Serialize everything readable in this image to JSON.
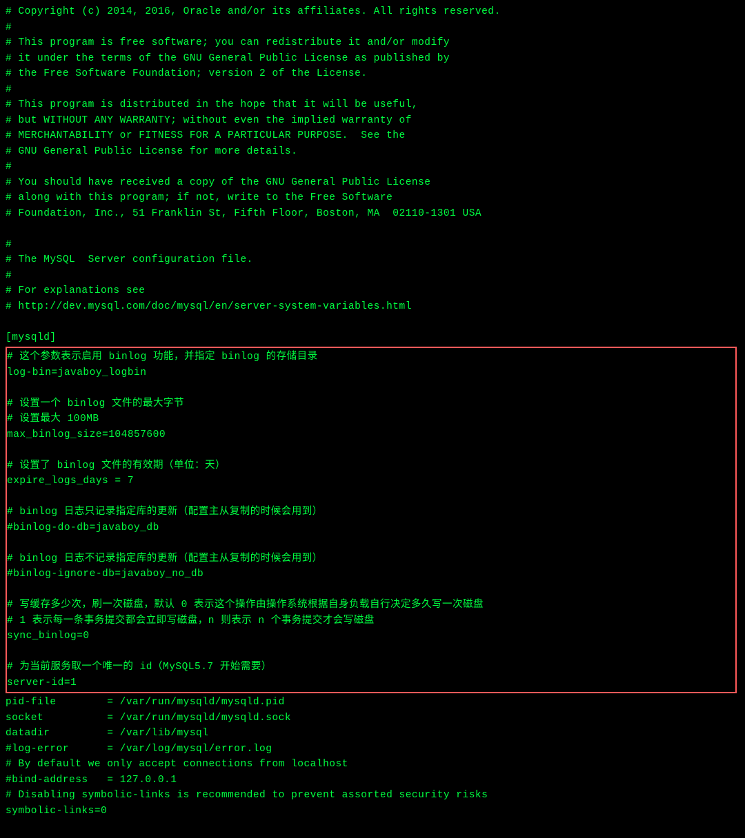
{
  "colors": {
    "background": "#000000",
    "text": "#00ff41",
    "highlightBorder": "#ff5a5a"
  },
  "preLines": [
    "# Copyright (c) 2014, 2016, Oracle and/or its affiliates. All rights reserved.",
    "#",
    "# This program is free software; you can redistribute it and/or modify",
    "# it under the terms of the GNU General Public License as published by",
    "# the Free Software Foundation; version 2 of the License.",
    "#",
    "# This program is distributed in the hope that it will be useful,",
    "# but WITHOUT ANY WARRANTY; without even the implied warranty of",
    "# MERCHANTABILITY or FITNESS FOR A PARTICULAR PURPOSE.  See the",
    "# GNU General Public License for more details.",
    "#",
    "# You should have received a copy of the GNU General Public License",
    "# along with this program; if not, write to the Free Software",
    "# Foundation, Inc., 51 Franklin St, Fifth Floor, Boston, MA  02110-1301 USA",
    "",
    "#",
    "# The MySQL  Server configuration file.",
    "#",
    "# For explanations see",
    "# http://dev.mysql.com/doc/mysql/en/server-system-variables.html",
    "",
    "[mysqld]"
  ],
  "highlightLines": [
    "# 这个参数表示启用 binlog 功能，并指定 binlog 的存储目录",
    "log-bin=javaboy_logbin",
    "",
    "# 设置一个 binlog 文件的最大字节",
    "# 设置最大 100MB",
    "max_binlog_size=104857600",
    "",
    "# 设置了 binlog 文件的有效期（单位：天）",
    "expire_logs_days = 7",
    "",
    "# binlog 日志只记录指定库的更新（配置主从复制的时候会用到）",
    "#binlog-do-db=javaboy_db",
    "",
    "# binlog 日志不记录指定库的更新（配置主从复制的时候会用到）",
    "#binlog-ignore-db=javaboy_no_db",
    "",
    "# 写缓存多少次，刷一次磁盘，默认 0 表示这个操作由操作系统根据自身负载自行决定多久写一次磁盘",
    "# 1 表示每一条事务提交都会立即写磁盘，n 则表示 n 个事务提交才会写磁盘",
    "sync_binlog=0",
    "",
    "# 为当前服务取一个唯一的 id（MySQL5.7 开始需要）",
    "server-id=1"
  ],
  "postLines": [
    "pid-file        = /var/run/mysqld/mysqld.pid",
    "socket          = /var/run/mysqld/mysqld.sock",
    "datadir         = /var/lib/mysql",
    "#log-error      = /var/log/mysql/error.log",
    "# By default we only accept connections from localhost",
    "#bind-address   = 127.0.0.1",
    "# Disabling symbolic-links is recommended to prevent assorted security risks",
    "symbolic-links=0"
  ]
}
